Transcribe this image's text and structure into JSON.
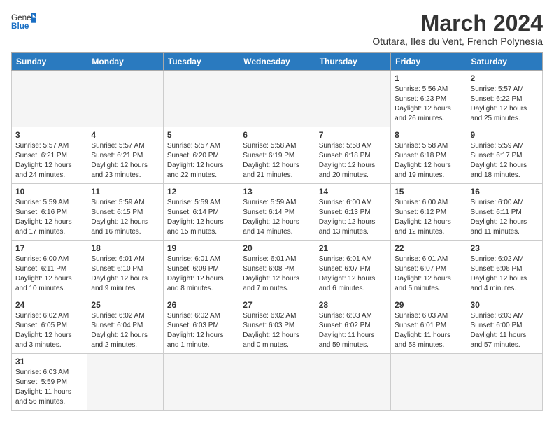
{
  "header": {
    "logo_general": "General",
    "logo_blue": "Blue",
    "main_title": "March 2024",
    "subtitle": "Otutara, Iles du Vent, French Polynesia"
  },
  "columns": [
    "Sunday",
    "Monday",
    "Tuesday",
    "Wednesday",
    "Thursday",
    "Friday",
    "Saturday"
  ],
  "weeks": [
    [
      {
        "day": "",
        "info": "",
        "empty": true
      },
      {
        "day": "",
        "info": "",
        "empty": true
      },
      {
        "day": "",
        "info": "",
        "empty": true
      },
      {
        "day": "",
        "info": "",
        "empty": true
      },
      {
        "day": "",
        "info": "",
        "empty": true
      },
      {
        "day": "1",
        "info": "Sunrise: 5:56 AM\nSunset: 6:23 PM\nDaylight: 12 hours\nand 26 minutes."
      },
      {
        "day": "2",
        "info": "Sunrise: 5:57 AM\nSunset: 6:22 PM\nDaylight: 12 hours\nand 25 minutes."
      }
    ],
    [
      {
        "day": "3",
        "info": "Sunrise: 5:57 AM\nSunset: 6:21 PM\nDaylight: 12 hours\nand 24 minutes."
      },
      {
        "day": "4",
        "info": "Sunrise: 5:57 AM\nSunset: 6:21 PM\nDaylight: 12 hours\nand 23 minutes."
      },
      {
        "day": "5",
        "info": "Sunrise: 5:57 AM\nSunset: 6:20 PM\nDaylight: 12 hours\nand 22 minutes."
      },
      {
        "day": "6",
        "info": "Sunrise: 5:58 AM\nSunset: 6:19 PM\nDaylight: 12 hours\nand 21 minutes."
      },
      {
        "day": "7",
        "info": "Sunrise: 5:58 AM\nSunset: 6:18 PM\nDaylight: 12 hours\nand 20 minutes."
      },
      {
        "day": "8",
        "info": "Sunrise: 5:58 AM\nSunset: 6:18 PM\nDaylight: 12 hours\nand 19 minutes."
      },
      {
        "day": "9",
        "info": "Sunrise: 5:59 AM\nSunset: 6:17 PM\nDaylight: 12 hours\nand 18 minutes."
      }
    ],
    [
      {
        "day": "10",
        "info": "Sunrise: 5:59 AM\nSunset: 6:16 PM\nDaylight: 12 hours\nand 17 minutes."
      },
      {
        "day": "11",
        "info": "Sunrise: 5:59 AM\nSunset: 6:15 PM\nDaylight: 12 hours\nand 16 minutes."
      },
      {
        "day": "12",
        "info": "Sunrise: 5:59 AM\nSunset: 6:14 PM\nDaylight: 12 hours\nand 15 minutes."
      },
      {
        "day": "13",
        "info": "Sunrise: 5:59 AM\nSunset: 6:14 PM\nDaylight: 12 hours\nand 14 minutes."
      },
      {
        "day": "14",
        "info": "Sunrise: 6:00 AM\nSunset: 6:13 PM\nDaylight: 12 hours\nand 13 minutes."
      },
      {
        "day": "15",
        "info": "Sunrise: 6:00 AM\nSunset: 6:12 PM\nDaylight: 12 hours\nand 12 minutes."
      },
      {
        "day": "16",
        "info": "Sunrise: 6:00 AM\nSunset: 6:11 PM\nDaylight: 12 hours\nand 11 minutes."
      }
    ],
    [
      {
        "day": "17",
        "info": "Sunrise: 6:00 AM\nSunset: 6:11 PM\nDaylight: 12 hours\nand 10 minutes."
      },
      {
        "day": "18",
        "info": "Sunrise: 6:01 AM\nSunset: 6:10 PM\nDaylight: 12 hours\nand 9 minutes."
      },
      {
        "day": "19",
        "info": "Sunrise: 6:01 AM\nSunset: 6:09 PM\nDaylight: 12 hours\nand 8 minutes."
      },
      {
        "day": "20",
        "info": "Sunrise: 6:01 AM\nSunset: 6:08 PM\nDaylight: 12 hours\nand 7 minutes."
      },
      {
        "day": "21",
        "info": "Sunrise: 6:01 AM\nSunset: 6:07 PM\nDaylight: 12 hours\nand 6 minutes."
      },
      {
        "day": "22",
        "info": "Sunrise: 6:01 AM\nSunset: 6:07 PM\nDaylight: 12 hours\nand 5 minutes."
      },
      {
        "day": "23",
        "info": "Sunrise: 6:02 AM\nSunset: 6:06 PM\nDaylight: 12 hours\nand 4 minutes."
      }
    ],
    [
      {
        "day": "24",
        "info": "Sunrise: 6:02 AM\nSunset: 6:05 PM\nDaylight: 12 hours\nand 3 minutes."
      },
      {
        "day": "25",
        "info": "Sunrise: 6:02 AM\nSunset: 6:04 PM\nDaylight: 12 hours\nand 2 minutes."
      },
      {
        "day": "26",
        "info": "Sunrise: 6:02 AM\nSunset: 6:03 PM\nDaylight: 12 hours\nand 1 minute."
      },
      {
        "day": "27",
        "info": "Sunrise: 6:02 AM\nSunset: 6:03 PM\nDaylight: 12 hours\nand 0 minutes."
      },
      {
        "day": "28",
        "info": "Sunrise: 6:03 AM\nSunset: 6:02 PM\nDaylight: 11 hours\nand 59 minutes."
      },
      {
        "day": "29",
        "info": "Sunrise: 6:03 AM\nSunset: 6:01 PM\nDaylight: 11 hours\nand 58 minutes."
      },
      {
        "day": "30",
        "info": "Sunrise: 6:03 AM\nSunset: 6:00 PM\nDaylight: 11 hours\nand 57 minutes."
      }
    ],
    [
      {
        "day": "31",
        "info": "Sunrise: 6:03 AM\nSunset: 5:59 PM\nDaylight: 11 hours\nand 56 minutes."
      },
      {
        "day": "",
        "info": "",
        "empty": true
      },
      {
        "day": "",
        "info": "",
        "empty": true
      },
      {
        "day": "",
        "info": "",
        "empty": true
      },
      {
        "day": "",
        "info": "",
        "empty": true
      },
      {
        "day": "",
        "info": "",
        "empty": true
      },
      {
        "day": "",
        "info": "",
        "empty": true
      }
    ]
  ]
}
